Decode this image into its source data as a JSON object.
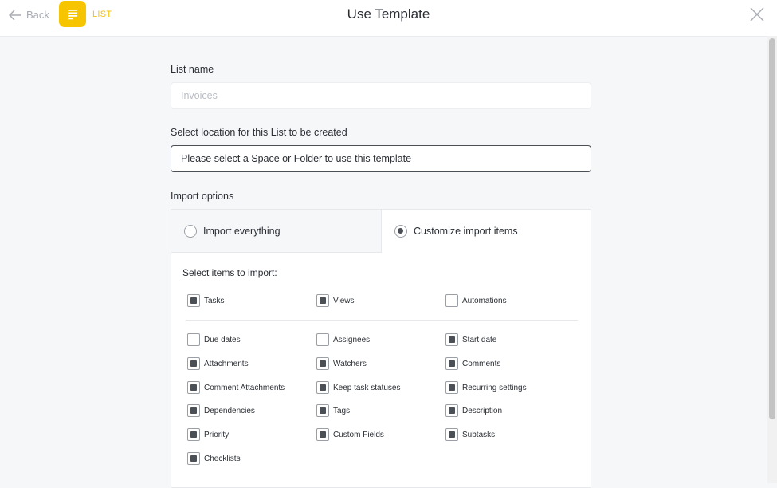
{
  "header": {
    "back_label": "Back",
    "type_label": "LIST",
    "title": "Use Template",
    "accent_color": "#f7c400"
  },
  "form": {
    "list_name_label": "List name",
    "list_name_placeholder": "Invoices",
    "location_label": "Select location for this List to be created",
    "location_value": "Please select a Space or Folder to use this template",
    "import_options_label": "Import options",
    "tabs": [
      {
        "label": "Import everything",
        "selected": false
      },
      {
        "label": "Customize import items",
        "selected": true
      }
    ],
    "select_items_label": "Select items to import:",
    "items": [
      {
        "label": "Tasks",
        "checked": true
      },
      {
        "label": "Views",
        "checked": true
      },
      {
        "label": "Automations",
        "checked": false
      },
      {
        "label": "Due dates",
        "checked": false
      },
      {
        "label": "Assignees",
        "checked": false
      },
      {
        "label": "Start date",
        "checked": true
      },
      {
        "label": "Attachments",
        "checked": true
      },
      {
        "label": "Watchers",
        "checked": true
      },
      {
        "label": "Comments",
        "checked": true
      },
      {
        "label": "Comment Attachments",
        "checked": true
      },
      {
        "label": "Keep task statuses",
        "checked": true
      },
      {
        "label": "Recurring settings",
        "checked": true
      },
      {
        "label": "Dependencies",
        "checked": true
      },
      {
        "label": "Tags",
        "checked": true
      },
      {
        "label": "Description",
        "checked": true
      },
      {
        "label": "Priority",
        "checked": true
      },
      {
        "label": "Custom Fields",
        "checked": true
      },
      {
        "label": "Subtasks",
        "checked": true
      },
      {
        "label": "Checklists",
        "checked": true
      }
    ]
  },
  "icons": {
    "back": "arrow-left-icon",
    "list": "list-lines-icon",
    "close": "close-icon"
  }
}
